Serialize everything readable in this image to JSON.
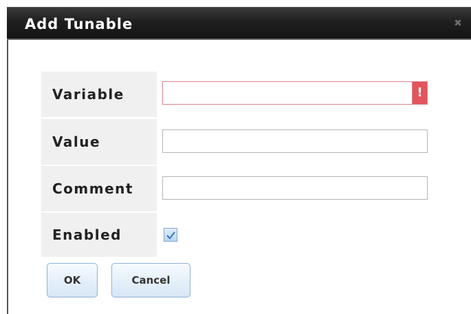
{
  "dialog": {
    "title": "Add Tunable",
    "close_icon": "close-icon"
  },
  "form": {
    "variable": {
      "label": "Variable",
      "value": "",
      "placeholder": "",
      "error_icon": "!"
    },
    "value": {
      "label": "Value",
      "value": "",
      "placeholder": ""
    },
    "comment": {
      "label": "Comment",
      "value": "",
      "placeholder": ""
    },
    "enabled": {
      "label": "Enabled",
      "checked": true
    }
  },
  "buttons": {
    "ok_label": "OK",
    "cancel_label": "Cancel"
  },
  "colors": {
    "error": "#e2555c",
    "title_bar": "#1f1f1f",
    "label_bg": "#f0f0f0"
  }
}
